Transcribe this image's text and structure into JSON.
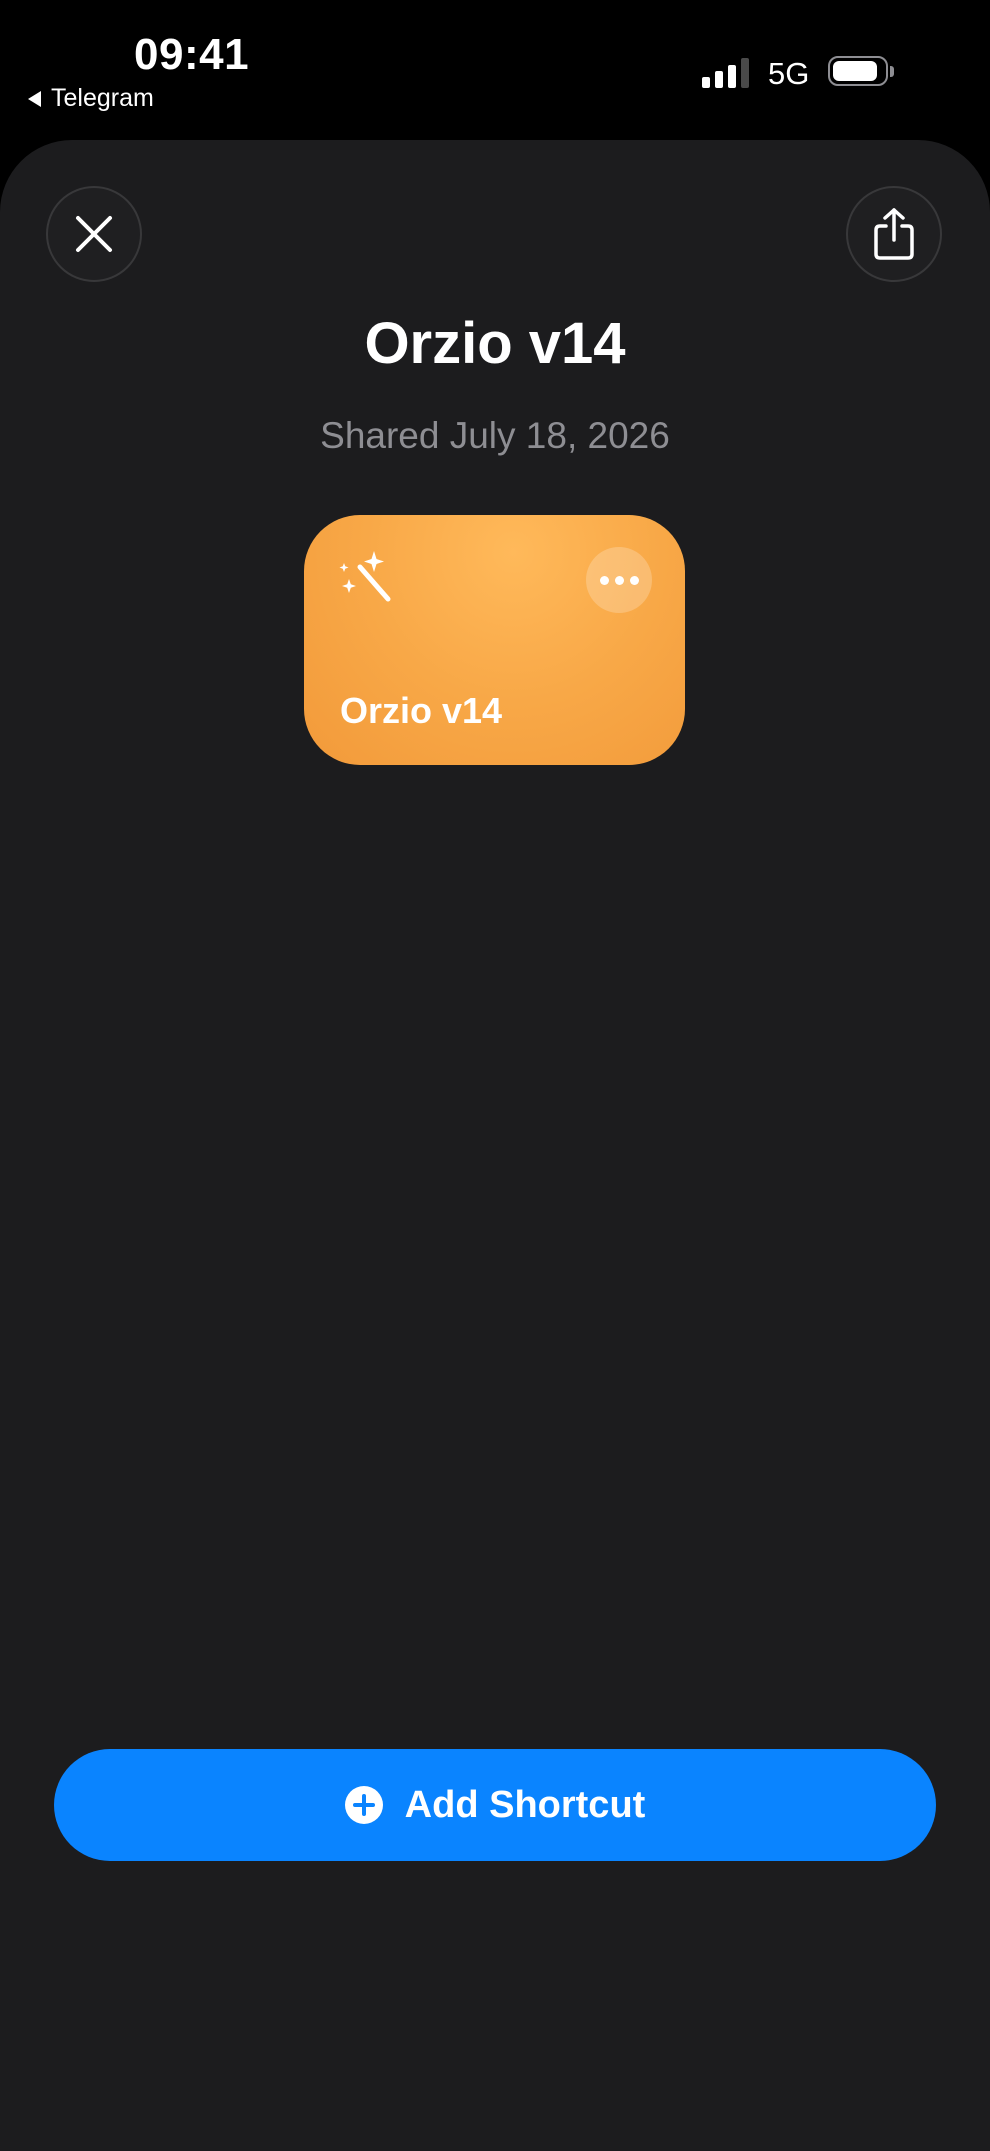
{
  "status_bar": {
    "time": "09:41",
    "back_app": "Telegram",
    "network": "5G"
  },
  "sheet": {
    "close_icon": "xmark-icon",
    "share_icon": "share-icon",
    "title": "Orzio v14",
    "subtitle": "Shared July 18, 2026"
  },
  "shortcut_card": {
    "name": "Orzio v14",
    "icon": "magic-wand-icon",
    "more_icon": "ellipsis-icon",
    "color": "#f8a847"
  },
  "add_button": {
    "label": "Add Shortcut",
    "icon": "plus-circle-icon",
    "color": "#0a84ff"
  }
}
